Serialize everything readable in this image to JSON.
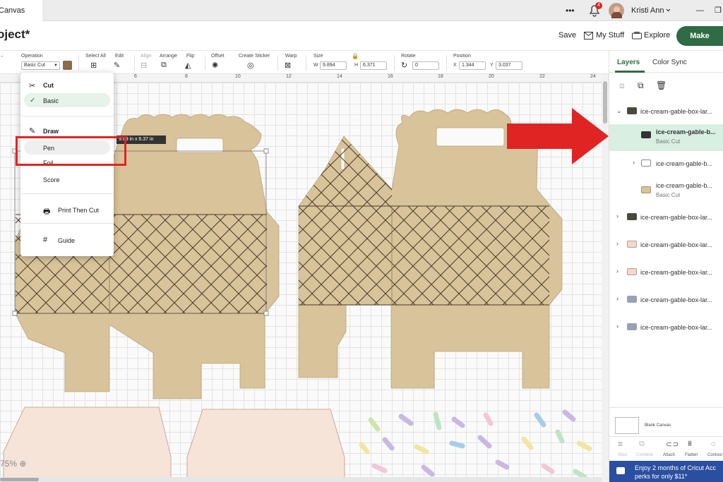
{
  "topbar": {
    "tab_label": "Canvas",
    "more": "•••",
    "notif_count": "4",
    "user_name": "Kristi Ann",
    "chevron": "⌄",
    "minimize": "—",
    "restore": "❐"
  },
  "header": {
    "project_title": "oject*",
    "save": "Save",
    "my_stuff": "My Stuff",
    "explore": "Explore",
    "make": "Make"
  },
  "toolbar": {
    "operation_label": "Operation",
    "operation_value": "Basic Cut",
    "select_all": "Select All",
    "edit": "Edit",
    "align": "Align",
    "arrange": "Arrange",
    "flip": "Flip",
    "offset": "Offset",
    "create_sticker": "Create Sticker",
    "warp": "Warp",
    "size": "Size",
    "w_label": "W",
    "w_value": "9.894",
    "h_label": "H",
    "h_value": "6.371",
    "rotate": "Rotate",
    "rotate_value": "0",
    "position": "Position",
    "x_label": "X",
    "x_value": "1.344",
    "y_label": "Y",
    "y_value": "3.037",
    "color_swatch": "#8b6c4a"
  },
  "ruler": {
    "ticks": [
      "6",
      "8",
      "10",
      "12",
      "14",
      "16",
      "18",
      "20",
      "22",
      "24"
    ]
  },
  "menu": {
    "cut": "Cut",
    "basic": "Basic",
    "draw": "Draw",
    "pen": "Pen",
    "foil": "Foil",
    "score": "Score",
    "print_then_cut": "Print Then Cut",
    "guide": "Guide"
  },
  "tooltip": "9.89 in x 6.37 in",
  "panel": {
    "tab_layers": "Layers",
    "tab_color_sync": "Color Sync",
    "layers": [
      {
        "name": "ice-cream-gable-box-lar...",
        "sub": "",
        "thumb": "#4a4a3a"
      },
      {
        "name": "ice-cream-gable-b...",
        "sub": "Basic Cut",
        "thumb": "#333333"
      },
      {
        "name": "ice-cream-gable-b...",
        "sub": "",
        "thumb": "#ffffff"
      },
      {
        "name": "ice-cream-gable-b...",
        "sub": "Basic Cut",
        "thumb": "#d8c39a"
      },
      {
        "name": "ice-cream-gable-box-lar...",
        "sub": "",
        "thumb": "#4a4a3a"
      },
      {
        "name": "ice-cream-gable-box-lar...",
        "sub": "",
        "thumb": "#f2d9cc"
      },
      {
        "name": "ice-cream-gable-box-lar...",
        "sub": "",
        "thumb": "#f2d9cc"
      },
      {
        "name": "ice-cream-gable-box-lar...",
        "sub": "",
        "thumb": "#9aa0b8"
      },
      {
        "name": "ice-cream-gable-box-lar...",
        "sub": "",
        "thumb": "#9aa0b8"
      }
    ],
    "blank_canvas": "Blank Canvas",
    "bottom_tools": [
      "Slice",
      "Combine",
      "Attach",
      "Flatten",
      "Contour"
    ],
    "promo_line1": "Enjoy 2 months of Cricut Acc",
    "promo_line2": "perks for only $11*"
  },
  "zoom": "75%",
  "colors": {
    "box_tan": "#d8c39a",
    "lattice": "#4a3a2a",
    "box_pink": "#f7e4d8",
    "accent_green": "#2f6b45",
    "arrow_red": "#e02424"
  }
}
